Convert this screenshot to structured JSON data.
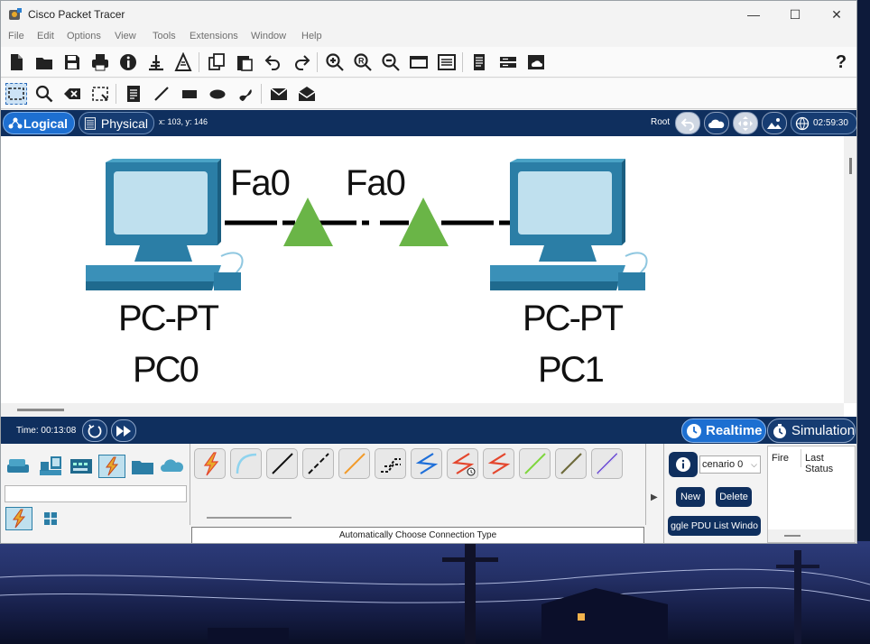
{
  "window": {
    "title": "Cisco Packet Tracer",
    "minimize_glyph": "—",
    "maximize_glyph": "☐",
    "close_glyph": "✕"
  },
  "menu": [
    "File",
    "Edit",
    "Options",
    "View",
    "Tools",
    "Extensions",
    "Window",
    "Help"
  ],
  "toolbar_main": [
    "new-file-icon",
    "open-folder-icon",
    "save-icon",
    "print-icon",
    "info-icon",
    "activity-wizard-icon",
    "packet-tracer-icon",
    "copy-icon",
    "paste-icon",
    "undo-icon",
    "redo-icon",
    "zoom-in-icon",
    "zoom-reset-icon",
    "zoom-out-icon",
    "palette-icon",
    "custom-device-dialog-icon",
    "pdu-list-icon",
    "network-info-icon",
    "cloud-icon",
    "help-icon"
  ],
  "help_glyph": "?",
  "toolbar_edit": [
    "select-icon",
    "inspect-icon",
    "delete-icon",
    "resize-shape-icon",
    "place-note-icon",
    "draw-line-icon",
    "draw-rectangle-icon",
    "draw-ellipse-icon",
    "draw-freeform-icon",
    "add-simple-pdu-icon",
    "add-complex-pdu-icon"
  ],
  "mode_bar": {
    "logical_label": "Logical",
    "physical_label": "Physical",
    "coordinates": "x: 103, y: 146",
    "root_label": "Root",
    "clock": "02:59:30"
  },
  "topology": {
    "devices": [
      {
        "model": "PC-PT",
        "name": "PC0"
      },
      {
        "model": "PC-PT",
        "name": "PC1"
      }
    ],
    "ports": [
      "Fa0",
      "Fa0"
    ],
    "link_status_color": "#6ab547"
  },
  "timebar": {
    "time": "Time: 00:13:08",
    "realtime_label": "Realtime",
    "simulation_label": "Simulation"
  },
  "device_panel": {
    "categories": [
      "network-devices-icon",
      "end-devices-icon",
      "components-icon",
      "connections-icon",
      "miscellaneous-icon",
      "multiuser-icon"
    ],
    "sub_categories": [
      "connections-icon",
      "grid-icon"
    ]
  },
  "connections": {
    "types": [
      "automatic-connection",
      "console-cable",
      "copper-straight-through",
      "copper-cross-over",
      "fiber",
      "phone-cable",
      "coaxial-cable",
      "serial-dce",
      "serial-dte",
      "octal-cable",
      "iot-custom-cable",
      "usb-cable"
    ],
    "label": "Automatically Choose Connection Type"
  },
  "scenario_panel": {
    "scenario": "cenario 0",
    "new_label": "New",
    "delete_label": "Delete",
    "toggle_label": "ggle PDU List Windo",
    "col_fire": "Fire",
    "col_last_status": "Last Status"
  },
  "colors": {
    "accent_blue": "#1d6fd1",
    "dark_navy": "#0f2f5e",
    "link_green": "#6ab547",
    "lightning_red": "#e4462d"
  }
}
